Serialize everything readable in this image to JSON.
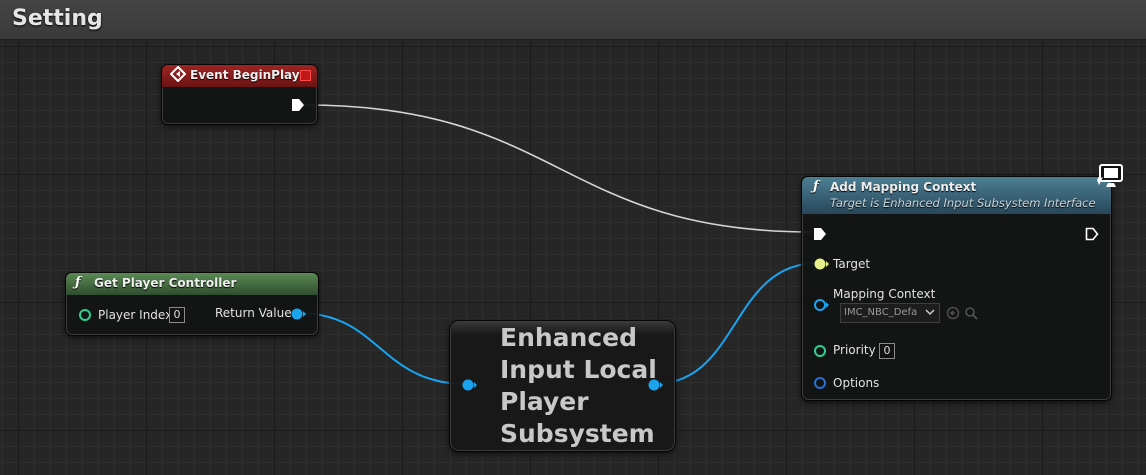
{
  "window": {
    "title": "Setting"
  },
  "nodes": {
    "event_begin_play": {
      "title": "Event BeginPlay",
      "header_color": "#8b1c1c"
    },
    "get_player_controller": {
      "title": "Get Player Controller",
      "header_color": "#3f6a3f",
      "player_index_label": "Player Index",
      "player_index_value": "0",
      "return_value_label": "Return Value"
    },
    "subsystem": {
      "title": "Enhanced\nInput Local\nPlayer\nSubsystem"
    },
    "add_mapping_context": {
      "title": "Add Mapping Context",
      "subtitle": "Target is Enhanced Input Subsystem Interface",
      "header_color": "#3b6478",
      "target_label": "Target",
      "mapping_context_label": "Mapping Context",
      "mapping_context_value": "IMC_NBC_Defa",
      "priority_label": "Priority",
      "priority_value": "0",
      "options_label": "Options"
    }
  },
  "colors": {
    "exec_wire": "#d8d8d8",
    "object_pin": "#1aa4ee",
    "target_pin": "#e6f08a",
    "int_pin": "#2ed08f",
    "struct_pin": "#2b6fd6"
  },
  "icons": [
    "event-diamond-icon",
    "function-icon",
    "monitor-icon",
    "reset-arrow-icon",
    "search-icon"
  ]
}
